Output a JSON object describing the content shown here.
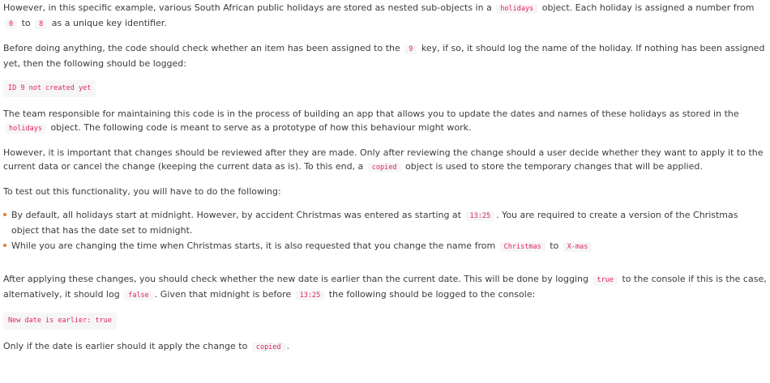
{
  "p1": {
    "t1": "However, in this specific example, various South African public holidays are stored as nested sub-objects in a ",
    "c1": "holidays",
    "t2": " object. Each holiday is assigned a number from ",
    "c2": "0",
    "t3": " to ",
    "c3": "8",
    "t4": " as a unique key identifier."
  },
  "p2": {
    "t1": "Before doing anything, the code should check whether an item has been assigned to the ",
    "c1": "9",
    "t2": " key, if so, it should log the name of the holiday. If nothing has been assigned yet, then the following should be logged:"
  },
  "code_block_1": "ID 9 not created yet",
  "p3": {
    "t1": "The team responsible for maintaining this code is in the process of building an app that allows you to update the dates and names of these holidays as stored in the ",
    "c1": "holidays",
    "t2": " object. The following code is meant to serve as a prototype of how this behaviour might work."
  },
  "p4": {
    "t1": "However, it is important that changes should be reviewed after they are made. Only after reviewing the change should a user decide whether they want to apply it to the current data or cancel the change (keeping the current data as is). To this end, a ",
    "c1": "copied",
    "t2": " object is used to store the temporary changes that will be applied."
  },
  "p5": "To test out this functionality, you will have to do the following:",
  "list": {
    "item1": {
      "t1": "By default, all holidays start at midnight. However, by accident Christmas was entered as starting at ",
      "c1": "13:25",
      "t2": ". You are required to create a version of the Christmas object that has the date set to midnight."
    },
    "item2": {
      "t1": "While you are changing the time when Christmas starts, it is also requested that you change the name from ",
      "c1": "Christmas",
      "t2": " to ",
      "c2": "X-mas"
    }
  },
  "p6": {
    "t1": "After applying these changes, you should check whether the new date is earlier than the current date. This will be done by logging ",
    "c1": "true",
    "t2": " to the console if this is the case, alternatively, it should log ",
    "c2": "false",
    "t3": ". Given that midnight is before ",
    "c3": "13:25",
    "t4": " the following should be logged to the console:"
  },
  "code_block_2": "New date is earlier: true",
  "p7": {
    "t1": "Only if the date is earlier should it apply the change to ",
    "c1": "copied",
    "t2": "."
  },
  "colors": {
    "text": "#3b3b3b",
    "code_text": "#e0245e",
    "code_background": "#f6f6f6",
    "bullet": "#e07a2e"
  }
}
